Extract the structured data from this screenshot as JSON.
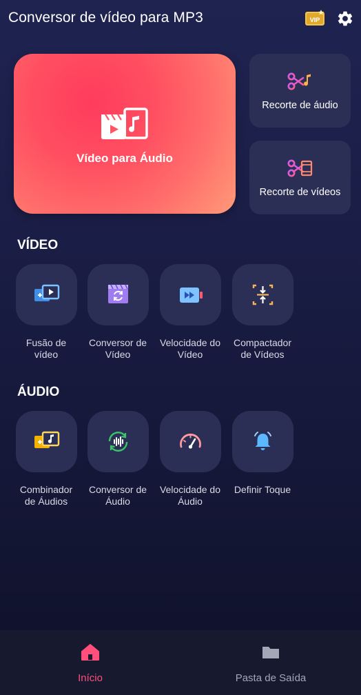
{
  "header": {
    "title": "Conversor de vídeo para MP3",
    "vip_label": "VIP",
    "vip_icon": "vip-crown-icon",
    "settings_icon": "gear-icon"
  },
  "hero": {
    "label": "Vídeo para Áudio",
    "icon": "video-to-audio-icon"
  },
  "side_cards": [
    {
      "label": "Recorte de áudio",
      "icon": "audio-cut-icon"
    },
    {
      "label": "Recorte de vídeos",
      "icon": "video-cut-icon"
    }
  ],
  "video_section": {
    "title": "VÍDEO",
    "tools": [
      {
        "label_line1": "Fusão de",
        "label_line2": "vídeo",
        "icon": "video-merge-icon"
      },
      {
        "label_line1": "Conversor de",
        "label_line2": "Vídeo",
        "icon": "video-convert-icon"
      },
      {
        "label_line1": "Velocidade do",
        "label_line2": "Vídeo",
        "icon": "video-speed-icon"
      },
      {
        "label_line1": "Compactador",
        "label_line2": "de Vídeos",
        "icon": "video-compress-icon"
      }
    ]
  },
  "audio_section": {
    "title": "ÁUDIO",
    "tools": [
      {
        "label_line1": "Combinador",
        "label_line2": "de Áudios",
        "icon": "audio-merge-icon"
      },
      {
        "label_line1": "Conversor de",
        "label_line2": "Áudio",
        "icon": "audio-convert-icon"
      },
      {
        "label_line1": "Velocidade do",
        "label_line2": "Áudio",
        "icon": "audio-speed-icon"
      },
      {
        "label_line1": "Definir Toque",
        "label_line2": "",
        "icon": "ringtone-bell-icon"
      }
    ]
  },
  "bottom_nav": {
    "items": [
      {
        "label": "Início",
        "icon": "home-icon",
        "active": true
      },
      {
        "label": "Pasta de Saída",
        "icon": "folder-icon",
        "active": false
      }
    ]
  },
  "colors": {
    "accent": "#ff4f7a",
    "card_bg": "#2c2f55",
    "hero_gradient_start": "#ff3c5c",
    "hero_gradient_end": "#ff9a78"
  }
}
